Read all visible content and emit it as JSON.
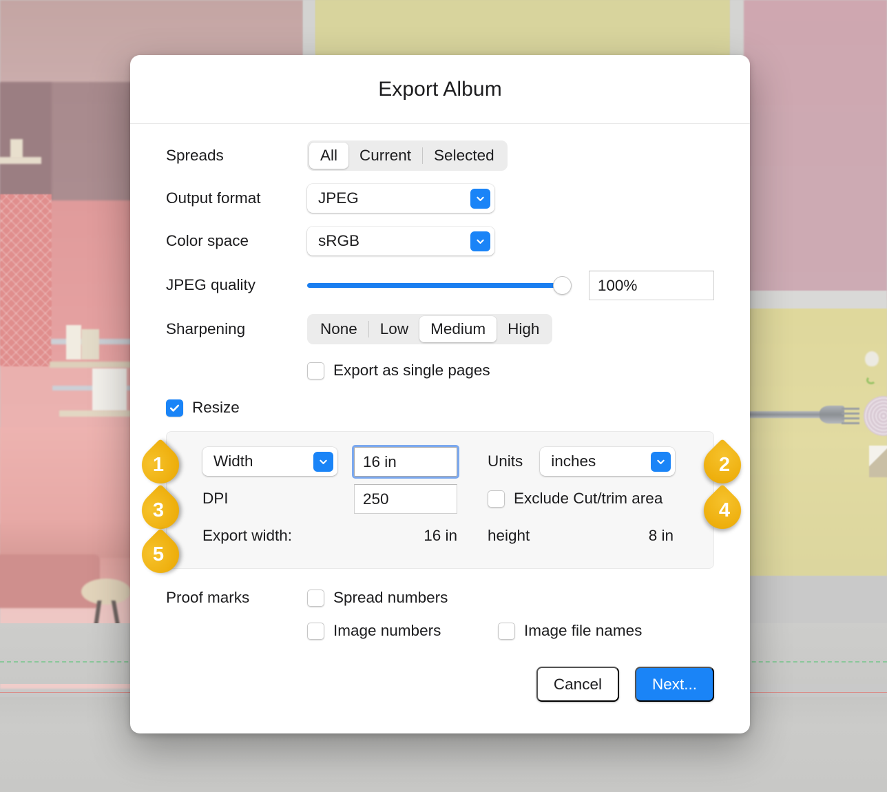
{
  "dialog": {
    "title": "Export Album"
  },
  "spreads": {
    "label": "Spreads",
    "options": [
      "All",
      "Current",
      "Selected"
    ],
    "selected": "All"
  },
  "output_format": {
    "label": "Output format",
    "value": "JPEG"
  },
  "color_space": {
    "label": "Color space",
    "value": "sRGB"
  },
  "jpeg_quality": {
    "label": "JPEG quality",
    "value": "100%",
    "percent": 100
  },
  "sharpening": {
    "label": "Sharpening",
    "options": [
      "None",
      "Low",
      "Medium",
      "High"
    ],
    "selected": "Medium"
  },
  "export_single_pages": {
    "label": "Export as single pages",
    "checked": false
  },
  "resize": {
    "label": "Resize",
    "checked": true,
    "dimension": {
      "value": "Width",
      "amount": "16 in"
    },
    "units": {
      "label": "Units",
      "value": "inches"
    },
    "dpi": {
      "label": "DPI",
      "value": "250"
    },
    "exclude_cut_trim": {
      "label": "Exclude Cut/trim area",
      "checked": false
    },
    "export_size": {
      "width_label": "Export width:",
      "width_value": "16 in",
      "height_label": "height",
      "height_value": "8 in"
    }
  },
  "proof_marks": {
    "label": "Proof marks",
    "spread_numbers": {
      "label": "Spread numbers",
      "checked": false
    },
    "image_numbers": {
      "label": "Image numbers",
      "checked": false
    },
    "image_file_names": {
      "label": "Image file names",
      "checked": false
    }
  },
  "footer": {
    "cancel_label": "Cancel",
    "next_label": "Next..."
  },
  "callouts": [
    {
      "number": "1"
    },
    {
      "number": "2"
    },
    {
      "number": "3"
    },
    {
      "number": "4"
    },
    {
      "number": "5"
    }
  ],
  "colors": {
    "accent_blue": "#1a84f7",
    "callout_gold": "#eeaf0d",
    "focus_ring": "#7ba8ee",
    "panel_bg": "#f7f7f7"
  }
}
